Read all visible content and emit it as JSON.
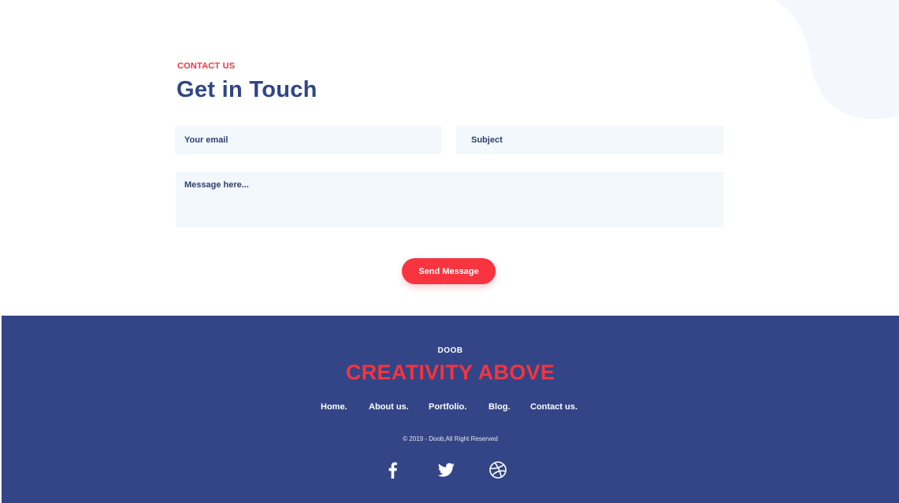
{
  "colors": {
    "accent": "#f7343f",
    "brand_navy": "#334586",
    "heading": "#2f4585",
    "field_background": "#f3f8fd",
    "blob": "#f4f8fd"
  },
  "contact": {
    "eyebrow": "CONTACT US",
    "title": "Get in Touch",
    "email_placeholder": "Your email",
    "subject_placeholder": "Subject",
    "message_placeholder": "Message here...",
    "send_label": "Send Message"
  },
  "footer": {
    "brand": "DOOB",
    "tagline": "CREATIVITY ABOVE",
    "nav": [
      {
        "label": "Home."
      },
      {
        "label": "About us."
      },
      {
        "label": "Portfolio."
      },
      {
        "label": "Blog."
      },
      {
        "label": "Contact us."
      }
    ],
    "copyright": "© 2019 - Doob,All Right Reserved",
    "social": [
      {
        "icon": "facebook-icon"
      },
      {
        "icon": "twitter-icon"
      },
      {
        "icon": "dribbble-icon"
      }
    ]
  }
}
